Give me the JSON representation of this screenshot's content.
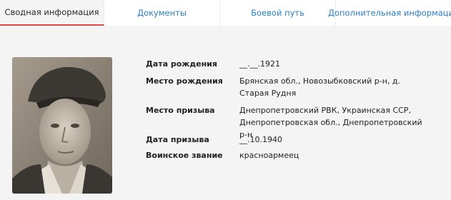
{
  "tabs": [
    {
      "label": "Сводная информация",
      "active": true
    },
    {
      "label": "Документы",
      "active": false
    },
    {
      "label": "Боевой путь",
      "active": false
    },
    {
      "label": "Дополнительная информация",
      "active": false
    }
  ],
  "info": {
    "birth_date_label": "Дата рождения",
    "birth_date_value": "__.__.1921",
    "birth_place_label": "Место рождения",
    "birth_place_value": "Брянская обл., Новозыбковский р-н, д. Старая Рудня",
    "conscription_place_label": "Место призыва",
    "conscription_place_value": "Днепропетровский РВК, Украинская ССР, Днепропетровская обл., Днепропетровский р-н",
    "conscription_date_label": "Дата призыва",
    "conscription_date_value": "__.10.1940",
    "rank_label": "Воинское звание",
    "rank_value": "красноармеец"
  },
  "colors": {
    "accent": "#d94a4a",
    "link": "#2a7fc9"
  }
}
